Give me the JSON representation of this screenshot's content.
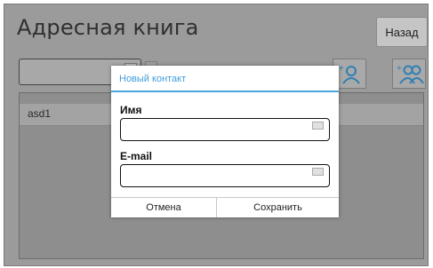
{
  "app": {
    "title": "Адресная книга",
    "back_label": "Назад"
  },
  "toolbar": {
    "search_value": "",
    "add_contact_icon": "add-person-icon",
    "add_group_icon": "add-group-icon"
  },
  "contacts": [
    {
      "name": "asd1"
    }
  ],
  "dialog": {
    "title": "Новый контакт",
    "name_label": "Имя",
    "name_value": "",
    "email_label": "E-mail",
    "email_value": "",
    "cancel_label": "Отмена",
    "save_label": "Сохранить"
  },
  "colors": {
    "accent": "#3f9ed9",
    "overlay_bg": "#9b9b9b"
  }
}
